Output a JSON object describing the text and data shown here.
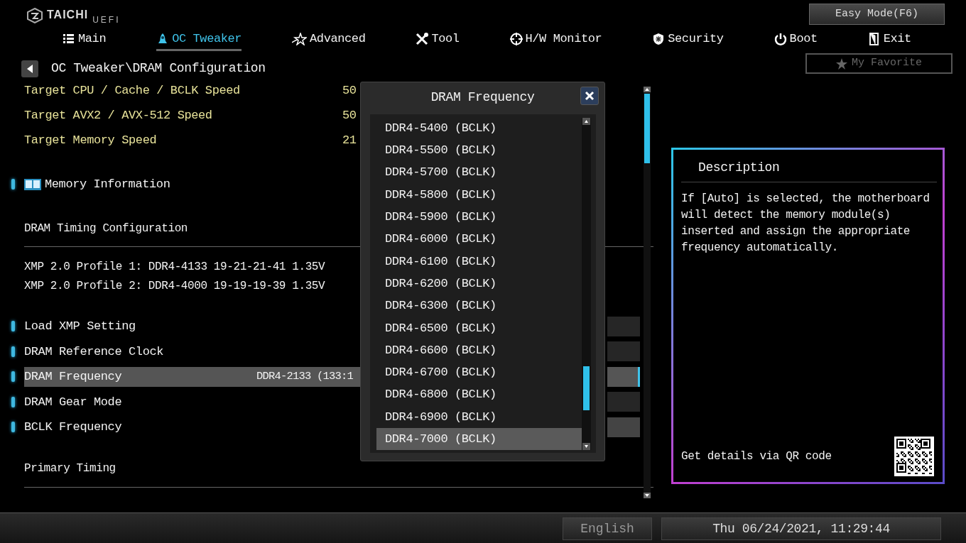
{
  "logo": {
    "brand": "TAICHI",
    "product": "UEFI"
  },
  "tabs": [
    {
      "label": "Main",
      "selected": false
    },
    {
      "label": "OC Tweaker",
      "selected": true
    },
    {
      "label": "Advanced",
      "selected": false
    },
    {
      "label": "Tool",
      "selected": false
    },
    {
      "label": "H/W Monitor",
      "selected": false
    },
    {
      "label": "Security",
      "selected": false
    },
    {
      "label": "Boot",
      "selected": false
    },
    {
      "label": "Exit",
      "selected": false
    }
  ],
  "easy_mode_button": "Easy Mode(F6)",
  "favorite_button": "My Favorite",
  "breadcrumb": "OC Tweaker\\DRAM Configuration",
  "items": [
    {
      "kind": "target",
      "label": "Target CPU / Cache / BCLK Speed",
      "value": "50"
    },
    {
      "kind": "target",
      "label": "Target AVX2 / AVX-512 Speed",
      "value": "50"
    },
    {
      "kind": "target",
      "label": "Target Memory Speed",
      "value": "21"
    },
    {
      "kind": "section",
      "label": "Memory Information"
    },
    {
      "kind": "heading",
      "label": "DRAM Timing Configuration"
    },
    {
      "kind": "info",
      "label": "XMP 2.0 Profile 1: DDR4-4133 19-21-21-41 1.35V"
    },
    {
      "kind": "info",
      "label": "XMP 2.0 Profile 2: DDR4-4000 19-19-19-39 1.35V"
    },
    {
      "kind": "setting",
      "label": "Load XMP Setting",
      "selected": false
    },
    {
      "kind": "setting",
      "label": "DRAM Reference Clock",
      "selected": false
    },
    {
      "kind": "setting",
      "label": "DRAM Frequency",
      "value": "DDR4-2133 (133:1",
      "selected": true
    },
    {
      "kind": "setting",
      "label": "DRAM Gear Mode",
      "selected": false
    },
    {
      "kind": "setting",
      "label": "BCLK Frequency",
      "selected": false
    },
    {
      "kind": "heading",
      "label": "Primary Timing"
    }
  ],
  "dialog": {
    "title": "DRAM Frequency",
    "options": [
      {
        "label": "DDR4-5400 (BCLK)",
        "selected": false
      },
      {
        "label": "DDR4-5500 (BCLK)",
        "selected": false
      },
      {
        "label": "DDR4-5700 (BCLK)",
        "selected": false
      },
      {
        "label": "DDR4-5800 (BCLK)",
        "selected": false
      },
      {
        "label": "DDR4-5900 (BCLK)",
        "selected": false
      },
      {
        "label": "DDR4-6000 (BCLK)",
        "selected": false
      },
      {
        "label": "DDR4-6100 (BCLK)",
        "selected": false
      },
      {
        "label": "DDR4-6200 (BCLK)",
        "selected": false
      },
      {
        "label": "DDR4-6300 (BCLK)",
        "selected": false
      },
      {
        "label": "DDR4-6500 (BCLK)",
        "selected": false
      },
      {
        "label": "DDR4-6600 (BCLK)",
        "selected": false
      },
      {
        "label": "DDR4-6700 (BCLK)",
        "selected": false
      },
      {
        "label": "DDR4-6800 (BCLK)",
        "selected": false
      },
      {
        "label": "DDR4-6900 (BCLK)",
        "selected": false
      },
      {
        "label": "DDR4-7000 (BCLK)",
        "selected": true
      }
    ]
  },
  "description": {
    "title": "Description",
    "text": "If [Auto] is selected, the motherboard will detect the memory module(s) inserted and assign the appropriate frequency automatically.",
    "qr_caption": "Get details via QR code"
  },
  "status_bar": {
    "language": "English",
    "datetime": "Thu 06/24/2021, 11:29:44"
  }
}
